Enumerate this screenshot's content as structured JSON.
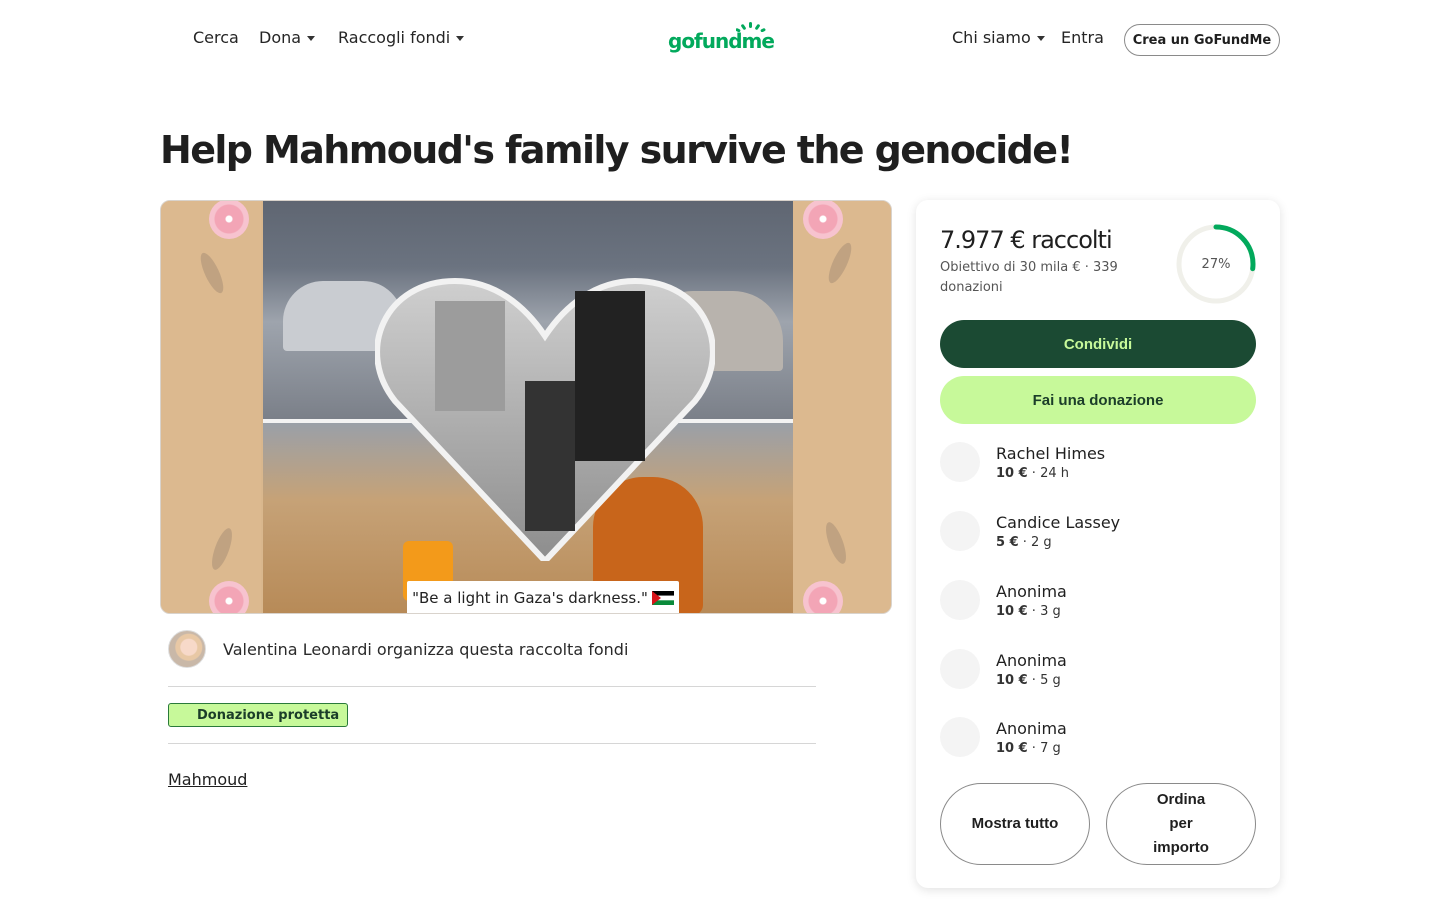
{
  "header": {
    "nav_left": [
      "Cerca",
      "Dona",
      "Raccogli fondi"
    ],
    "logo_text": "gofundme",
    "nav_right": [
      "Chi siamo",
      "Entra"
    ],
    "create_button": "Crea un GoFundMe"
  },
  "campaign": {
    "title": "Help Mahmoud's family survive the genocide!",
    "image_caption": "\"Be a light in Gaza's darkness.\"",
    "organizer_text": "Valentina Leonardi organizza questa raccolta fondi",
    "protected_badge": "Donazione protetta",
    "beneficiary": "Mahmoud"
  },
  "donation_card": {
    "raised": "7.977 € raccolti",
    "subtitle": "Obiettivo di 30 mila € · 339 donazioni",
    "progress_label": "27%",
    "progress_fraction": 0.27,
    "share_button": "Condividi",
    "donate_button": "Fai una donazione",
    "donors": [
      {
        "name": "Rachel Himes",
        "amount": "10 €",
        "time": " · 24 h"
      },
      {
        "name": "Candice Lassey",
        "amount": "5 €",
        "time": " · 2 g"
      },
      {
        "name": "Anonima",
        "amount": "10 €",
        "time": " · 3 g"
      },
      {
        "name": "Anonima",
        "amount": "10 €",
        "time": " · 5 g"
      },
      {
        "name": "Anonima",
        "amount": "10 €",
        "time": " · 7 g"
      }
    ],
    "show_all_button": "Mostra tutto",
    "sort_button": "Ordina per importo"
  },
  "colors": {
    "brand_green": "#02a95c",
    "dark_green": "#1b4a33",
    "lime": "#c7f99a"
  }
}
